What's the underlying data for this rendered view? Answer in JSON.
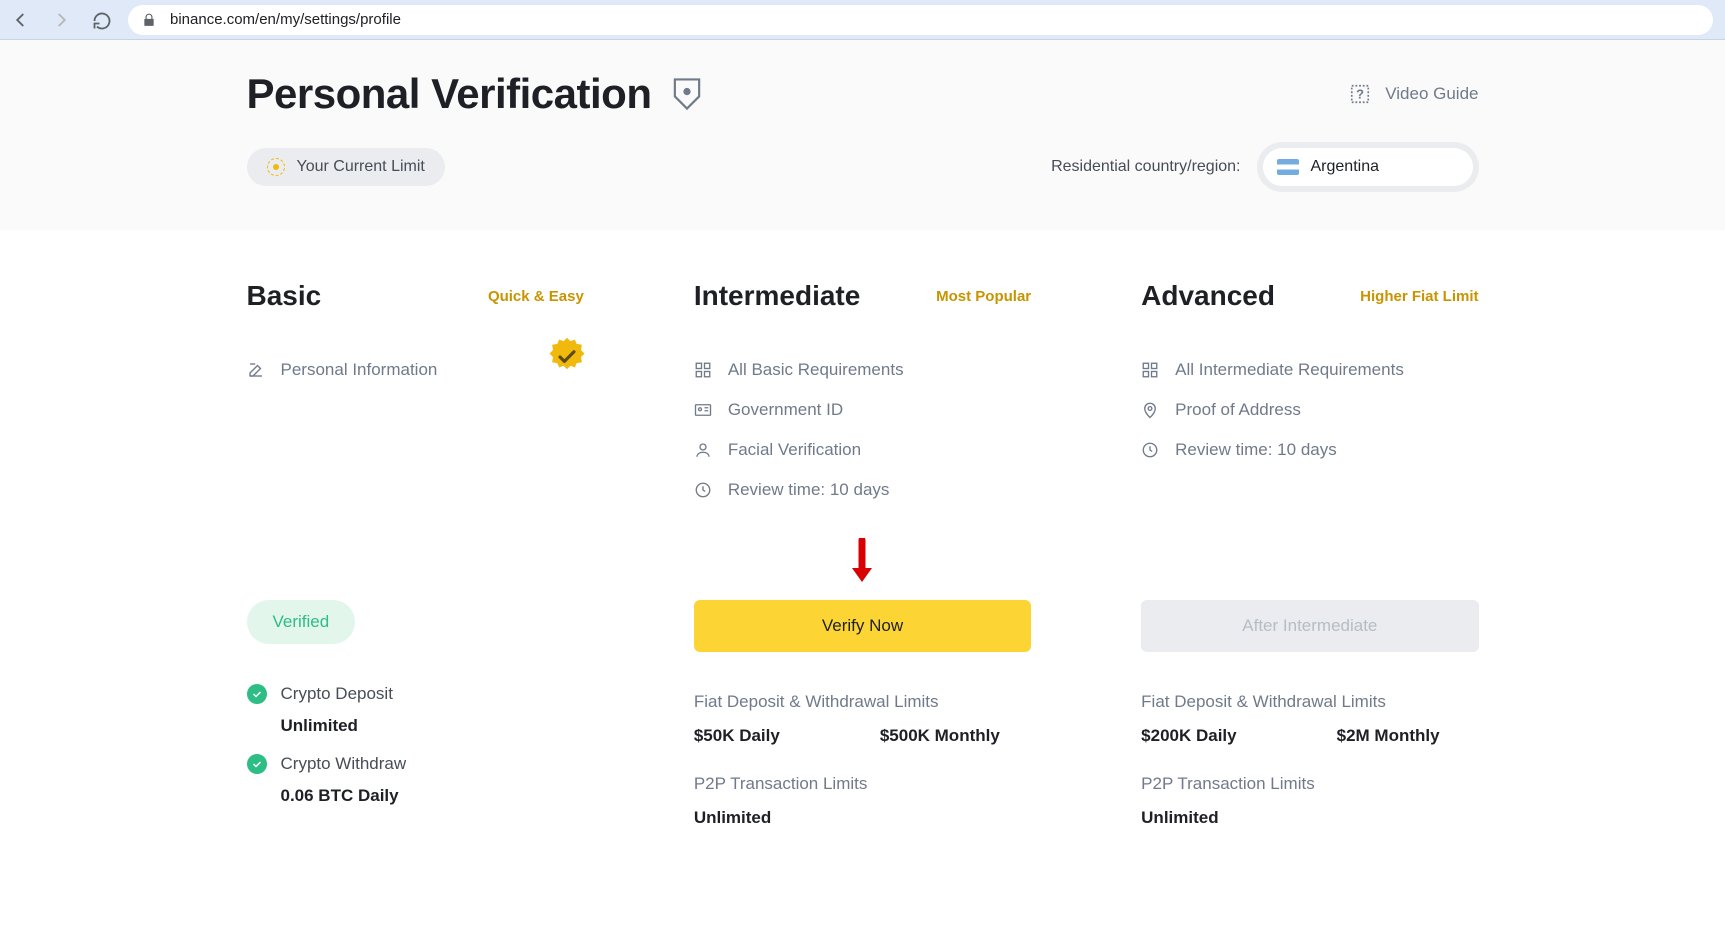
{
  "browser": {
    "url": "binance.com/en/my/settings/profile"
  },
  "page": {
    "title": "Personal Verification",
    "video_guide": "Video Guide",
    "current_limit_label": "Your Current Limit",
    "country_label": "Residential country/region:",
    "country_value": "Argentina"
  },
  "tiers": [
    {
      "name": "Basic",
      "tag": "Quick & Easy",
      "requirements": [
        {
          "icon": "edit",
          "label": "Personal Information"
        }
      ],
      "status": {
        "type": "verified",
        "label": "Verified"
      },
      "limits": [
        {
          "check": true,
          "label": "Crypto Deposit",
          "value": "Unlimited"
        },
        {
          "check": true,
          "label": "Crypto Withdraw",
          "value": "0.06 BTC Daily"
        }
      ]
    },
    {
      "name": "Intermediate",
      "tag": "Most Popular",
      "requirements": [
        {
          "icon": "grid",
          "label": "All Basic Requirements"
        },
        {
          "icon": "id",
          "label": "Government ID"
        },
        {
          "icon": "face",
          "label": "Facial Verification"
        },
        {
          "icon": "clock",
          "label": "Review time: 10 days"
        }
      ],
      "status": {
        "type": "cta",
        "label": "Verify Now"
      },
      "fiat_label": "Fiat Deposit & Withdrawal Limits",
      "fiat_values": [
        "$50K Daily",
        "$500K Monthly"
      ],
      "p2p_label": "P2P Transaction Limits",
      "p2p_value": "Unlimited"
    },
    {
      "name": "Advanced",
      "tag": "Higher Fiat Limit",
      "requirements": [
        {
          "icon": "grid",
          "label": "All Intermediate Requirements"
        },
        {
          "icon": "pin",
          "label": "Proof of Address"
        },
        {
          "icon": "clock",
          "label": "Review time: 10 days"
        }
      ],
      "status": {
        "type": "disabled",
        "label": "After Intermediate"
      },
      "fiat_label": "Fiat Deposit & Withdrawal Limits",
      "fiat_values": [
        "$200K Daily",
        "$2M Monthly"
      ],
      "p2p_label": "P2P Transaction Limits",
      "p2p_value": "Unlimited"
    }
  ]
}
